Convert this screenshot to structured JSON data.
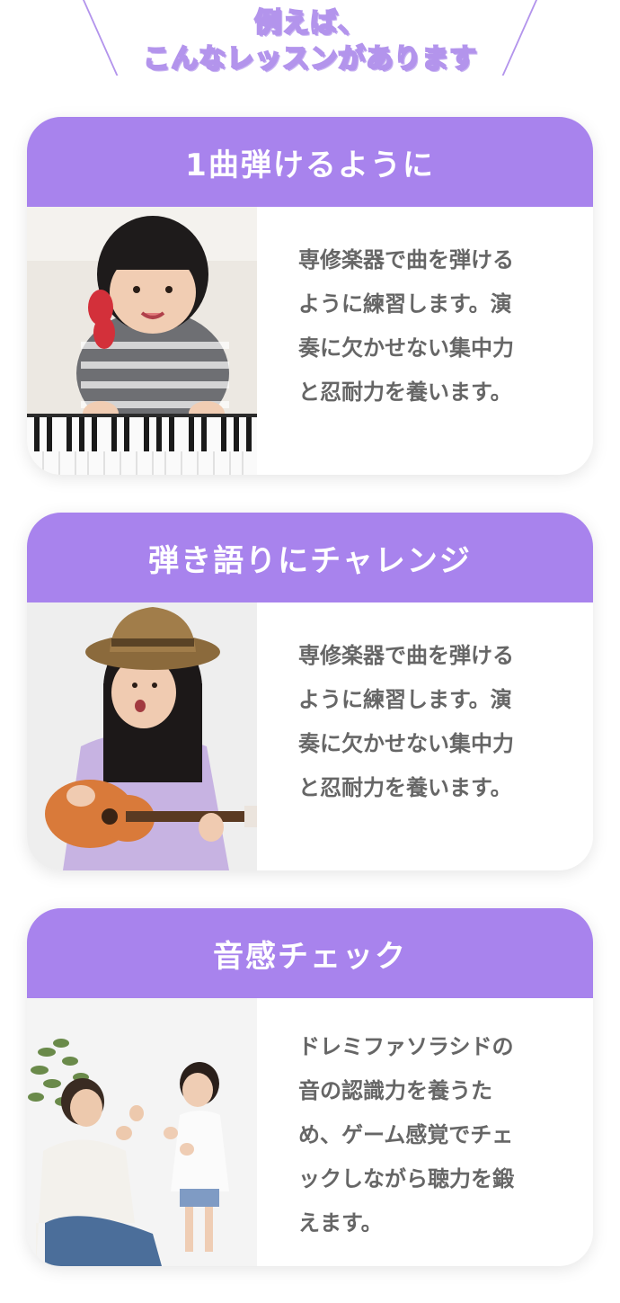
{
  "heading": {
    "line1": "例えば、",
    "line2": "こんなレッスンがあります"
  },
  "cards": [
    {
      "title": "1曲弾けるように",
      "lines": [
        "専修楽器で曲を弾ける",
        "ように練習します。演",
        "奏に欠かせない集中力",
        "と忍耐力を養います。"
      ]
    },
    {
      "title": "弾き語りにチャレンジ",
      "lines": [
        "専修楽器で曲を弾ける",
        "ように練習します。演",
        "奏に欠かせない集中力",
        "と忍耐力を養います。"
      ]
    },
    {
      "title": "音感チェック",
      "lines": [
        "ドレミファソラシドの",
        "音の認識力を養うた",
        "め、ゲーム感覚でチェ",
        "ックしながら聴力を鍛",
        "えます。"
      ]
    }
  ],
  "colors": {
    "accent": "#a883ed",
    "heading_outline": "#b394ec",
    "body_text": "#666666"
  }
}
